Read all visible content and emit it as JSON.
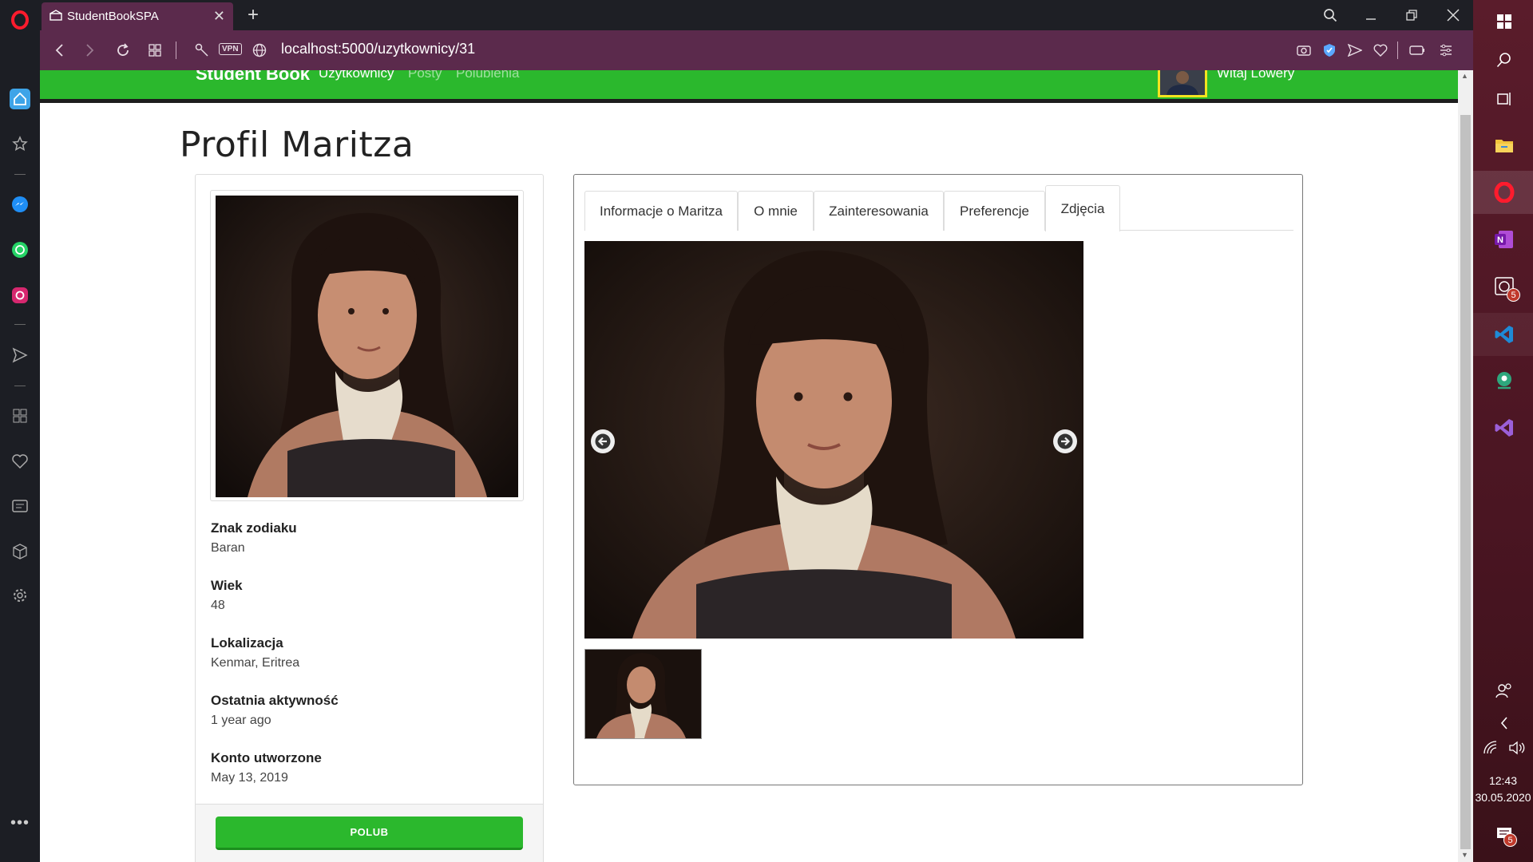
{
  "browser": {
    "tab_title": "StudentBookSPA",
    "url": "localhost:5000/uzytkownicy/31",
    "vpn_label": "VPN"
  },
  "site": {
    "brand": "Student Book",
    "nav": [
      "Użytkownicy",
      "Posty",
      "Polubienia"
    ],
    "welcome": "Witaj Lowery"
  },
  "profile": {
    "title": "Profil Maritza",
    "fields": [
      {
        "label": "Znak zodiaku",
        "value": "Baran"
      },
      {
        "label": "Wiek",
        "value": "48"
      },
      {
        "label": "Lokalizacja",
        "value": "Kenmar, Eritrea"
      },
      {
        "label": "Ostatnia aktywność",
        "value": "1 year ago"
      },
      {
        "label": "Konto utworzone",
        "value": "May 13, 2019"
      }
    ],
    "like_button": "POLUB"
  },
  "tabs": [
    "Informacje o Maritza",
    "O mnie",
    "Zainteresowania",
    "Preferencje",
    "Zdjęcia"
  ],
  "active_tab": "Zdjęcia",
  "taskbar": {
    "time": "12:43",
    "date": "30.05.2020",
    "badges": [
      "5",
      "5"
    ]
  },
  "colors": {
    "brand_green": "#2bb82d",
    "opera_purple": "#5b2a4c",
    "taskbar": "#4a1522"
  }
}
